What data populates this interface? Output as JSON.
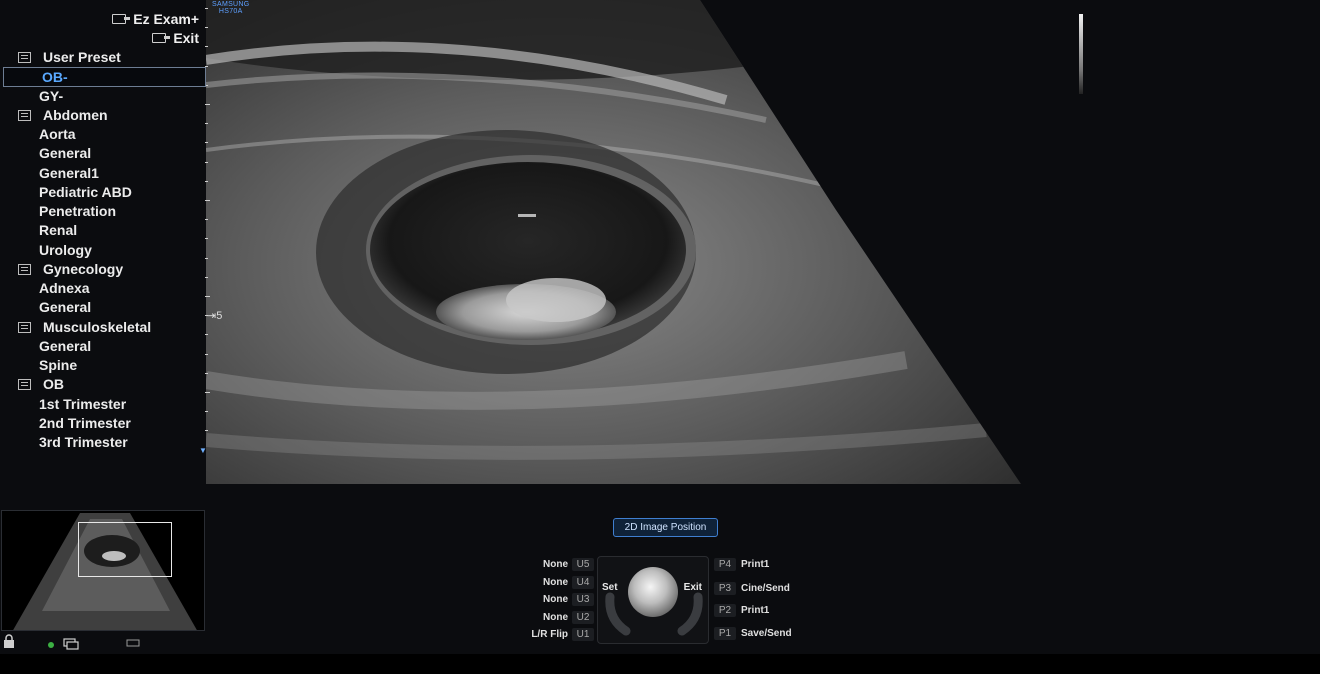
{
  "top_buttons": {
    "ez_exam": "Ez Exam+",
    "exit": "Exit"
  },
  "brand": {
    "line1": "SAMSUNG",
    "line2": "HS70A"
  },
  "presets": [
    {
      "label": "User Preset",
      "type": "group"
    },
    {
      "label": "OB-",
      "type": "item",
      "selected": true
    },
    {
      "label": "GY-",
      "type": "item"
    },
    {
      "label": "Abdomen",
      "type": "group"
    },
    {
      "label": "Aorta",
      "type": "item"
    },
    {
      "label": "General",
      "type": "item"
    },
    {
      "label": "General1",
      "type": "item"
    },
    {
      "label": "Pediatric ABD",
      "type": "item"
    },
    {
      "label": "Penetration",
      "type": "item"
    },
    {
      "label": "Renal",
      "type": "item"
    },
    {
      "label": "Urology",
      "type": "item"
    },
    {
      "label": "Gynecology",
      "type": "group"
    },
    {
      "label": "Adnexa",
      "type": "item"
    },
    {
      "label": "General",
      "type": "item"
    },
    {
      "label": "Musculoskeletal",
      "type": "group"
    },
    {
      "label": "General",
      "type": "item"
    },
    {
      "label": "Spine",
      "type": "item"
    },
    {
      "label": "OB",
      "type": "group"
    },
    {
      "label": "1st Trimester",
      "type": "item"
    },
    {
      "label": "2nd Trimester",
      "type": "item"
    },
    {
      "label": "3rd Trimester",
      "type": "item"
    }
  ],
  "depth_marker": "5",
  "image_position_button": "2D Image Position",
  "user_keys": [
    {
      "label": "None",
      "key": "U5"
    },
    {
      "label": "None",
      "key": "U4"
    },
    {
      "label": "None",
      "key": "U3"
    },
    {
      "label": "None",
      "key": "U2"
    },
    {
      "label": "L/R Flip",
      "key": "U1"
    }
  ],
  "print_keys": [
    {
      "key": "P4",
      "label": "Print1"
    },
    {
      "key": "P3",
      "label": "Cine/Send"
    },
    {
      "key": "P2",
      "label": "Print1"
    },
    {
      "key": "P1",
      "label": "Save/Send"
    }
  ],
  "trackball": {
    "set": "Set",
    "exit": "Exit"
  },
  "colors": {
    "accent": "#3f7fd0",
    "selected_text": "#5aa9ff",
    "background": "#0b0c0f"
  }
}
